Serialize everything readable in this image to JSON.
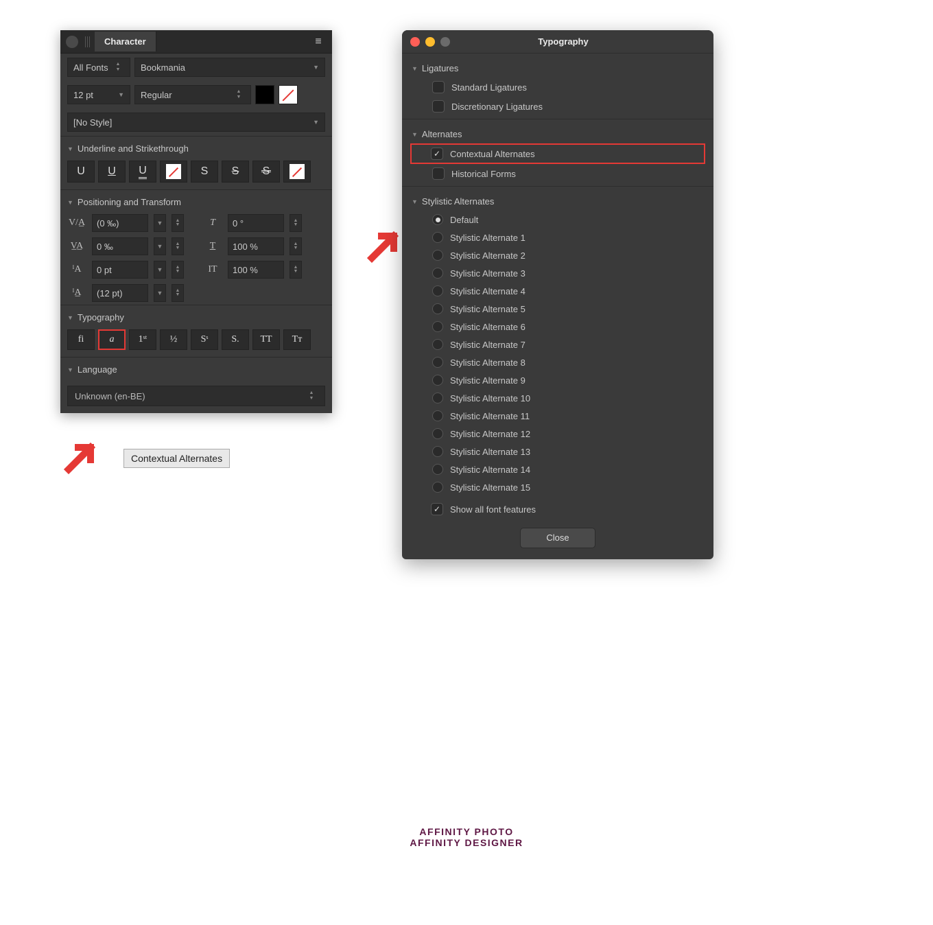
{
  "char": {
    "tab": "Character",
    "fontCat": "All Fonts",
    "fontFamily": "Bookmania",
    "size": "12 pt",
    "weight": "Regular",
    "style": "[No Style]",
    "sections": {
      "uline": "Underline and Strikethrough",
      "pos": "Positioning and Transform",
      "typo": "Typography",
      "lang": "Language"
    },
    "uline_buttons": [
      "U",
      "U",
      "U",
      "",
      "S",
      "S",
      "S",
      ""
    ],
    "pos": {
      "kern": "(0 ‰)",
      "track": "0 ‰",
      "baseline": "0 pt",
      "leading": "(12 pt)",
      "italic": "0 °",
      "hscale": "100 %",
      "vscale": "100 %"
    },
    "typo_buttons": [
      "fi",
      "a",
      "1ˢᵗ",
      "½",
      "Sˢ",
      "S.",
      "TT",
      "Tᴛ"
    ],
    "tooltip": "Contextual Alternates",
    "language": "Unknown (en-BE)"
  },
  "typo": {
    "title": "Typography",
    "ligatures": {
      "head": "Ligatures",
      "std": "Standard Ligatures",
      "disc": "Discretionary Ligatures"
    },
    "alternates": {
      "head": "Alternates",
      "contextual": "Contextual Alternates",
      "historical": "Historical Forms"
    },
    "stylistic": {
      "head": "Stylistic Alternates",
      "default": "Default",
      "items": [
        "Stylistic Alternate 1",
        "Stylistic Alternate 2",
        "Stylistic Alternate 3",
        "Stylistic Alternate 4",
        "Stylistic Alternate 5",
        "Stylistic Alternate 6",
        "Stylistic Alternate 7",
        "Stylistic Alternate 8",
        "Stylistic Alternate 9",
        "Stylistic Alternate 10",
        "Stylistic Alternate 11",
        "Stylistic Alternate 12",
        "Stylistic Alternate 13",
        "Stylistic Alternate 14",
        "Stylistic Alternate 15"
      ]
    },
    "showAll": "Show all font features",
    "close": "Close"
  },
  "caption1": "AFFINITY PHOTO",
  "caption2": "AFFINITY DESIGNER"
}
